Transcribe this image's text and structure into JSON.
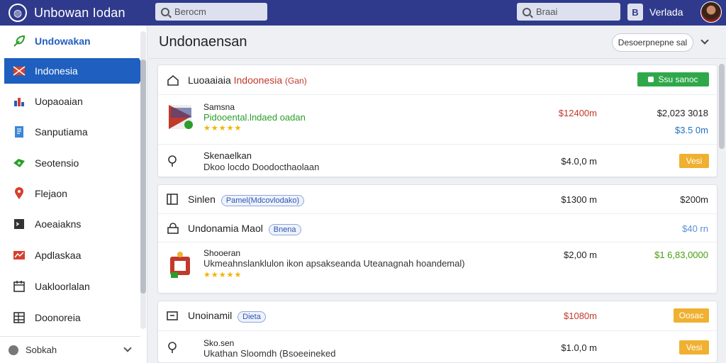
{
  "app": {
    "title": "Unbowan Iodan"
  },
  "search": {
    "main_placeholder": "Berocm",
    "right_placeholder": "Braai"
  },
  "user": {
    "name": "Verlada",
    "icon_letter": "B"
  },
  "sidebar": {
    "items": [
      {
        "label": "Undowakan",
        "icon": "leaf-icon",
        "color": "#2a9d2a"
      },
      {
        "label": "Indonesia",
        "icon": "flag-icon",
        "color": "#d6402f"
      },
      {
        "label": "Uopaoaian",
        "icon": "chart-icon",
        "color": "#1f5fbf"
      },
      {
        "label": "Sanputiama",
        "icon": "document-icon",
        "color": "#3a86d6"
      },
      {
        "label": "Seotensio",
        "icon": "cash-icon",
        "color": "#2a9d2a"
      },
      {
        "label": "Flejaon",
        "icon": "pin-icon",
        "color": "#d6402f"
      },
      {
        "label": "Aoeaiakns",
        "icon": "terminal-icon",
        "color": "#333333"
      },
      {
        "label": "Apdlaskaa",
        "icon": "chart-red-icon",
        "color": "#d6402f"
      },
      {
        "label": "Uakloorlalan",
        "icon": "calendar-icon",
        "color": "#333333"
      },
      {
        "label": "Doonoreia",
        "icon": "grid-icon",
        "color": "#333333"
      }
    ],
    "footer_label": "Sobkah"
  },
  "main": {
    "title": "Undonaensan",
    "sort_label": "Desoerpnepne sal"
  },
  "cards": [
    {
      "header": {
        "title": "Luoaaiaia",
        "title_red": "Indoonesia",
        "suffix": "(Gan)",
        "button": "Ssu sanoc"
      },
      "items": [
        {
          "name": "Samsna",
          "desc": "Pidooental.lndaed oadan",
          "stars": "★★★★★",
          "price_a": "$12400m",
          "price_b": "$2,023 3018",
          "price_c": "$3.5 0m"
        },
        {
          "name": "Skenaelkan",
          "desc": "Dkoo locdo Doodocthaolaan",
          "price_a": "$4.0,0 m",
          "button": "Vesi"
        }
      ]
    },
    {
      "rows": [
        {
          "title": "Sinlen",
          "tag": "Pamel(Mdcovlodako)",
          "price_a": "$1300 m",
          "price_b": "$200m"
        },
        {
          "title": "Undonamia Maol",
          "tag": "Bnena",
          "price_b": "$40 rn"
        },
        {
          "name": "Shooeran",
          "desc": "Ukmeahnslanklulon ikon apsakseanda Uteanagnah hoandemal)",
          "stars": "★★★★★",
          "price_a": "$2,00 m",
          "price_b": "$1 6,83,0000"
        }
      ]
    },
    {
      "rows": [
        {
          "title": "Unoinamil",
          "tag": "Dieta",
          "price_a": "$1080m",
          "button": "Oosac"
        },
        {
          "name": "Sko.sen",
          "desc": "Ukathan Sloomdh (Bsoeeineked",
          "price_a": "$1.0,0 m",
          "button": "Vesi"
        }
      ]
    }
  ]
}
